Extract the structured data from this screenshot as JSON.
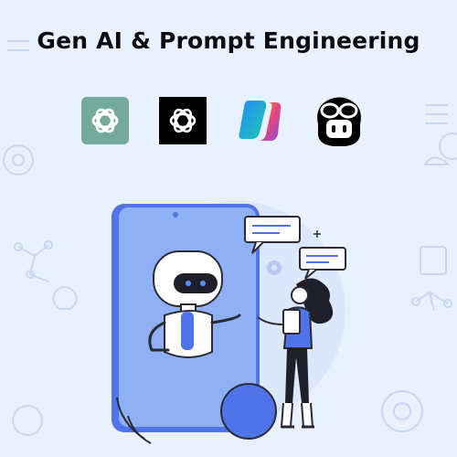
{
  "header": {
    "title": "Gen AI & Prompt Engineering"
  },
  "logos": [
    {
      "icon": "chatgpt-green-icon",
      "color": "#74aa9c"
    },
    {
      "icon": "chatgpt-black-icon",
      "color": "#000000"
    },
    {
      "icon": "copilot-icon",
      "color": "#2f7cf6"
    },
    {
      "icon": "github-copilot-icon",
      "color": "#000000"
    }
  ],
  "colors": {
    "background": "#e8f1fc",
    "accent": "#4f73e8",
    "phone_screen": "#8fb0f4",
    "text": "#0b0b12"
  }
}
